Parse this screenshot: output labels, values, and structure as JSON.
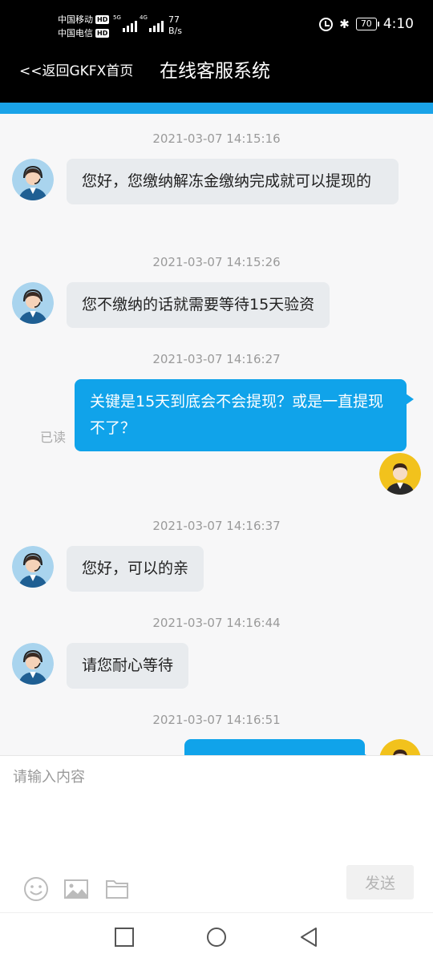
{
  "status_bar": {
    "carrier1": "中国移动",
    "carrier2": "中国电信",
    "hd": "HD",
    "net1": "5G",
    "net2": "4G",
    "speed_value": "77",
    "speed_unit": "B/s",
    "battery": "70",
    "time": "4:10"
  },
  "header": {
    "back_label": "<<返回GKFX首页",
    "title": "在线客服系统"
  },
  "messages": [
    {
      "time": "2021-03-07 14:15:16",
      "from": "agent",
      "text": "您好，您缴纳解冻金缴纳完成就可以提现的"
    },
    {
      "time": "2021-03-07 14:15:26",
      "from": "agent",
      "text": "您不缴纳的话就需要等待15天验资"
    },
    {
      "time": "2021-03-07 14:16:27",
      "from": "user",
      "text": "关键是15天到底会不会提现？或是一直提现不了？",
      "status": "已读"
    },
    {
      "time": "2021-03-07 14:16:37",
      "from": "agent",
      "text": "您好，可以的亲"
    },
    {
      "time": "2021-03-07 14:16:44",
      "from": "agent",
      "text": "请您耐心等待"
    },
    {
      "time": "2021-03-07 14:16:51",
      "from": "user",
      "text": ""
    }
  ],
  "input": {
    "placeholder": "请输入内容",
    "send_label": "发送"
  },
  "colors": {
    "header_bg": "#000000",
    "accent_blue": "#10a3ea",
    "incoming_bubble": "#e8ebee"
  },
  "icons": [
    "emoji-icon",
    "image-icon",
    "folder-icon",
    "nav-square-icon",
    "nav-circle-icon",
    "nav-back-triangle-icon"
  ]
}
